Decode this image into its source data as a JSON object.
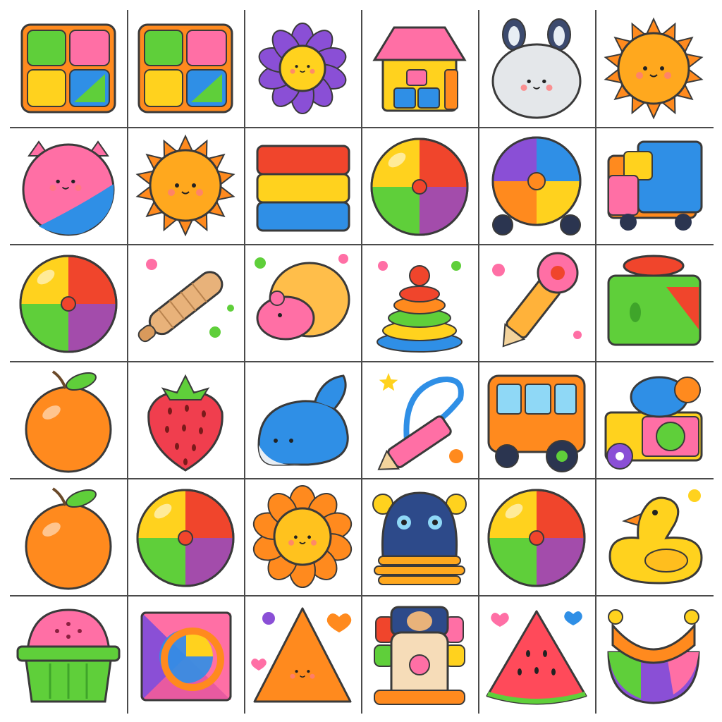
{
  "board": {
    "rows": 6,
    "cols": 6,
    "line_color": "#4a4a4a",
    "background": "#ffffff"
  },
  "tiles": [
    {
      "id": "r1c1",
      "icon": "block-puzzle-icon"
    },
    {
      "id": "r1c2",
      "icon": "block-puzzle-icon"
    },
    {
      "id": "r1c3",
      "icon": "flower-icon"
    },
    {
      "id": "r1c4",
      "icon": "toy-house-icon"
    },
    {
      "id": "r1c5",
      "icon": "bunny-face-icon"
    },
    {
      "id": "r1c6",
      "icon": "sun-face-icon"
    },
    {
      "id": "r2c1",
      "icon": "pig-ball-icon"
    },
    {
      "id": "r2c2",
      "icon": "sun-face-icon"
    },
    {
      "id": "r2c3",
      "icon": "stacked-blocks-icon"
    },
    {
      "id": "r2c4",
      "icon": "beach-ball-icon"
    },
    {
      "id": "r2c5",
      "icon": "ball-car-icon"
    },
    {
      "id": "r2c6",
      "icon": "cube-truck-icon"
    },
    {
      "id": "r3c1",
      "icon": "beach-ball-icon"
    },
    {
      "id": "r3c2",
      "icon": "rolling-pin-icon"
    },
    {
      "id": "r3c3",
      "icon": "pink-mouse-icon"
    },
    {
      "id": "r3c4",
      "icon": "ring-stacker-icon"
    },
    {
      "id": "r3c5",
      "icon": "crayon-rattle-icon"
    },
    {
      "id": "r3c6",
      "icon": "shape-sorter-icon"
    },
    {
      "id": "r4c1",
      "icon": "orange-fruit-icon"
    },
    {
      "id": "r4c2",
      "icon": "strawberry-icon"
    },
    {
      "id": "r4c3",
      "icon": "whale-icon"
    },
    {
      "id": "r4c4",
      "icon": "crayon-loop-icon"
    },
    {
      "id": "r4c5",
      "icon": "bus-icon"
    },
    {
      "id": "r4c6",
      "icon": "toy-truck-icon"
    },
    {
      "id": "r5c1",
      "icon": "orange-fruit-icon"
    },
    {
      "id": "r5c2",
      "icon": "beach-ball-icon"
    },
    {
      "id": "r5c3",
      "icon": "sun-flower-face-icon"
    },
    {
      "id": "r5c4",
      "icon": "bear-stacker-icon"
    },
    {
      "id": "r5c5",
      "icon": "beach-ball-icon"
    },
    {
      "id": "r5c6",
      "icon": "rubber-duck-icon"
    },
    {
      "id": "r6c1",
      "icon": "sand-bucket-icon"
    },
    {
      "id": "r6c2",
      "icon": "shape-frame-icon"
    },
    {
      "id": "r6c3",
      "icon": "cone-face-icon"
    },
    {
      "id": "r6c4",
      "icon": "bear-toy-icon"
    },
    {
      "id": "r6c5",
      "icon": "watermelon-slice-icon"
    },
    {
      "id": "r6c6",
      "icon": "rocking-toy-icon"
    }
  ],
  "colors": {
    "red": "#f0452c",
    "orange": "#ff8a1e",
    "yellow": "#ffd21e",
    "green": "#5fcf3a",
    "blue": "#2f8fe6",
    "purple": "#8a4fd6",
    "pink": "#ff6fa5",
    "outline": "#3a3a3a"
  }
}
